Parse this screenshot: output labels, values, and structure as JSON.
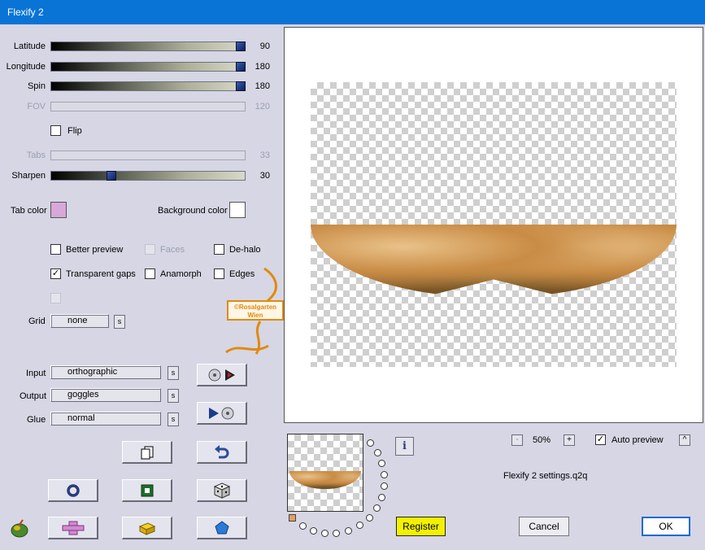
{
  "window": {
    "title": "Flexify 2"
  },
  "sliders": [
    {
      "label": "Latitude",
      "value": "90",
      "enabled": true,
      "fraction": 1.0
    },
    {
      "label": "Longitude",
      "value": "180",
      "enabled": true,
      "fraction": 1.0
    },
    {
      "label": "Spin",
      "value": "180",
      "enabled": true,
      "fraction": 1.0
    },
    {
      "label": "FOV",
      "value": "120",
      "enabled": false,
      "fraction": 0
    },
    {
      "label": "Tabs",
      "value": "33",
      "enabled": false,
      "fraction": 0
    },
    {
      "label": "Sharpen",
      "value": "30",
      "enabled": true,
      "fraction": 0.3
    }
  ],
  "flip": {
    "label": "Flip",
    "checked": false
  },
  "colors": {
    "tab_label": "Tab color",
    "tab_value": "#d8a8d8",
    "background_label": "Background color",
    "background_value": "#ffffff"
  },
  "options": {
    "better_preview": {
      "label": "Better preview",
      "checked": false
    },
    "faces": {
      "label": "Faces",
      "checked": false
    },
    "de_halo": {
      "label": "De-halo",
      "checked": false
    },
    "transparent_gaps": {
      "label": "Transparent gaps",
      "checked": true
    },
    "anamorph": {
      "label": "Anamorph",
      "checked": false
    },
    "edges": {
      "label": "Edges",
      "checked": false
    }
  },
  "grid": {
    "label": "Grid",
    "value": "none",
    "s_label": "s"
  },
  "projection": {
    "input_label": "Input",
    "input_value": "orthographic",
    "output_label": "Output",
    "output_value": "goggles",
    "glue_label": "Glue",
    "glue_value": "normal",
    "s_label": "s"
  },
  "watermark": {
    "line1": "©Rosalgarten",
    "line2": "Wien"
  },
  "zoom": {
    "minus": "-",
    "value": "50%",
    "plus": "+"
  },
  "auto_preview": {
    "label": "Auto preview",
    "checked": true,
    "toggle": "^"
  },
  "settings_file": "Flexify 2 settings.q2q",
  "buttons": {
    "register": "Register",
    "cancel": "Cancel",
    "ok": "OK"
  },
  "info_glyph": "i",
  "accent_colors": {
    "title_bar": "#0a74d6",
    "register": "#f2f200"
  }
}
